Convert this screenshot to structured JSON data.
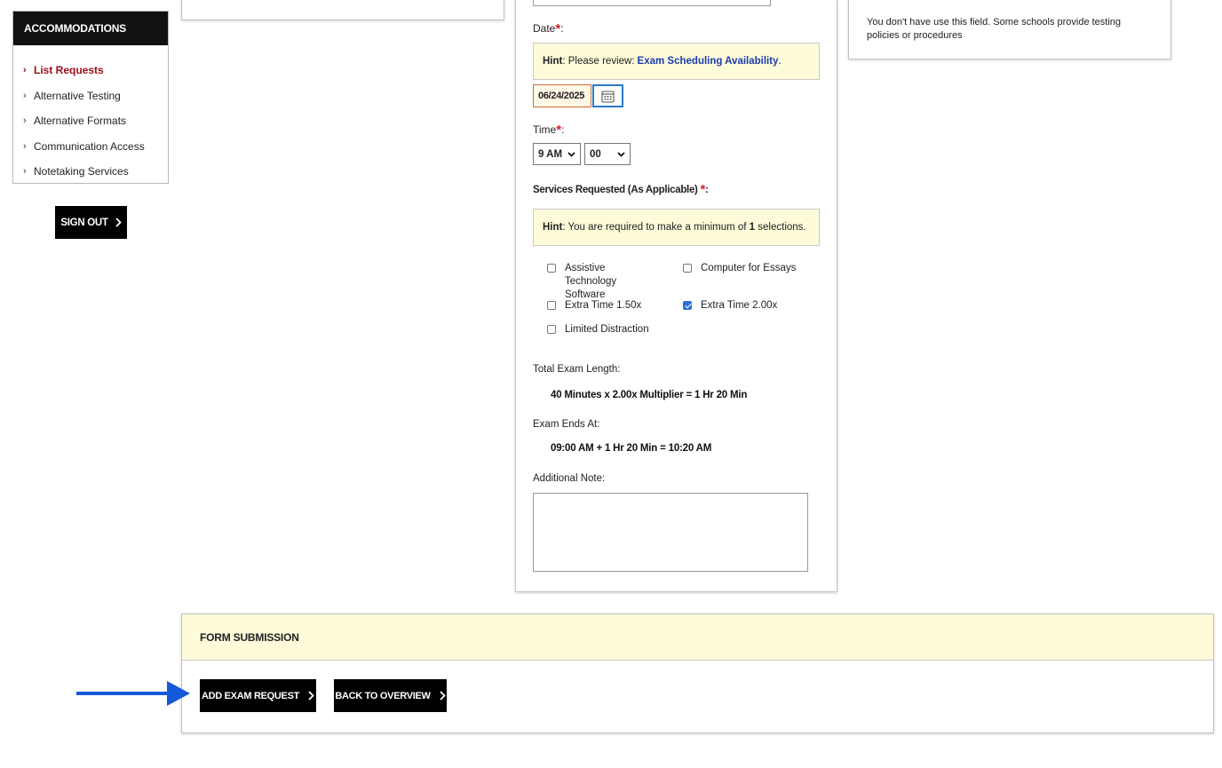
{
  "sidebar": {
    "header": "ACCOMMODATIONS",
    "items": [
      {
        "label": "List Requests",
        "active": true
      },
      {
        "label": "Alternative Testing"
      },
      {
        "label": "Alternative Formats"
      },
      {
        "label": "Communication Access"
      },
      {
        "label": "Notetaking Services"
      }
    ],
    "signout_label": "SIGN OUT"
  },
  "policy_note": "You don't have use this field. Some schools provide testing policies or procedures",
  "form": {
    "date": {
      "label": "Date",
      "required_mark": "*",
      "colon": ":",
      "hint_prefix": "Hint",
      "hint_text": ": Please review:",
      "hint_link": "Exam Scheduling Availability",
      "hint_suffix": ".",
      "value": "06/24/2025"
    },
    "time": {
      "label": "Time",
      "required_mark": "*",
      "colon": ":",
      "hour": "9 AM",
      "minute": "00"
    },
    "services": {
      "label": "Services Requested (As Applicable)",
      "required_mark": "*",
      "colon": ":",
      "hint_prefix": "Hint",
      "hint_text": ": You are required to make a minimum of",
      "hint_count": "1",
      "hint_suffix": "selections.",
      "options": [
        {
          "label": "Assistive Technology Software",
          "checked": false
        },
        {
          "label": "Computer for Essays",
          "checked": false
        },
        {
          "label": "Extra Time 1.50x",
          "checked": false
        },
        {
          "label": "Extra Time 2.00x",
          "checked": true
        },
        {
          "label": "Limited Distraction",
          "checked": false
        }
      ]
    },
    "total_length": {
      "label": "Total Exam Length:",
      "value": "40 Minutes x 2.00x Multiplier = 1 Hr 20 Min"
    },
    "ends_at": {
      "label": "Exam Ends At:",
      "value": "09:00 AM + 1 Hr 20 Min = 10:20 AM"
    },
    "note": {
      "label": "Additional Note:",
      "value": ""
    }
  },
  "submission": {
    "header": "FORM SUBMISSION",
    "add_label": "ADD EXAM REQUEST",
    "back_label": "BACK TO OVERVIEW"
  },
  "colors": {
    "accent_red": "#9b0d17",
    "required_red": "#d0202e",
    "hint_bg": "#fdfbd9",
    "link_blue": "#1d3bb0",
    "annotation_arrow": "#1459d9"
  },
  "icons": {
    "chevron": "chevron-right-icon",
    "calendar": "calendar-icon",
    "arrow": "arrow-right-icon"
  }
}
